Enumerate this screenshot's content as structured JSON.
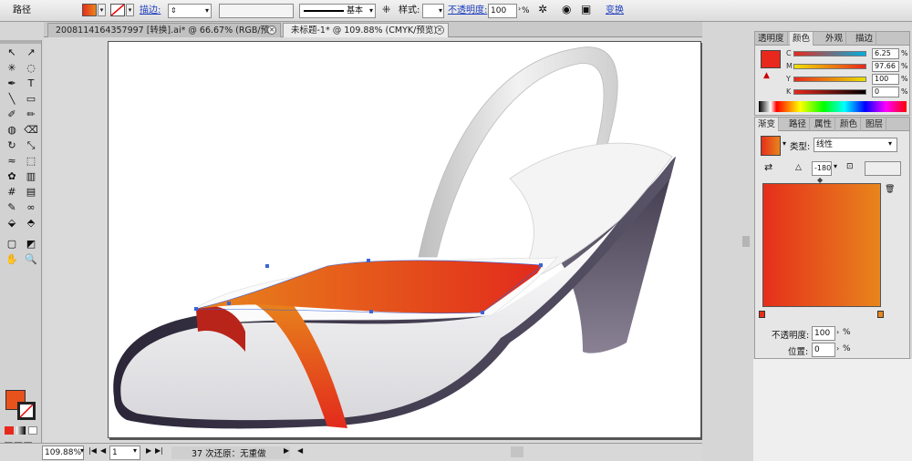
{
  "control_bar": {
    "object_label": "路径",
    "stroke_label": "描边:",
    "stroke_profile": "基本",
    "style_label": "样式:",
    "opacity_label": "不透明度:",
    "opacity_value": "100",
    "opacity_unit": "%",
    "transform_label": "变换"
  },
  "doc_tabs": [
    {
      "title": "2008114164357997 [转换].ai* @ 66.67% (RGB/预览)"
    },
    {
      "title": "未标题-1* @ 109.88% (CMYK/预览)"
    }
  ],
  "status": {
    "zoom": "109.88%",
    "page": "1",
    "undo_text": "37 次还原：无重做"
  },
  "color_panel": {
    "tabs": [
      "透明度",
      "颜色",
      "外观",
      "描边"
    ],
    "active_tab": "颜色",
    "channels": [
      {
        "label": "C",
        "value": "6.25",
        "unit": "%"
      },
      {
        "label": "M",
        "value": "97.66",
        "unit": "%"
      },
      {
        "label": "Y",
        "value": "100",
        "unit": "%"
      },
      {
        "label": "K",
        "value": "0",
        "unit": "%"
      }
    ],
    "fill_color": "#e8281c"
  },
  "gradient_panel": {
    "tabs": [
      "渐变",
      "路径",
      "属性",
      "颜色",
      "图层"
    ],
    "active_tab": "渐变",
    "type_label": "类型:",
    "type_value": "线性",
    "angle_value": "-180",
    "opacity_label": "不透明度:",
    "opacity_value": "100",
    "location_label": "位置:",
    "location_value": "0",
    "unit": "%",
    "gradient_start": "#e52f1b",
    "gradient_end": "#e8851c"
  },
  "toolbox": {
    "tool_icons": [
      "selection-icon",
      "direct-selection-icon",
      "magic-wand-icon",
      "lasso-icon",
      "pen-icon",
      "type-icon",
      "line-icon",
      "rectangle-icon",
      "paintbrush-icon",
      "pencil-icon",
      "blob-brush-icon",
      "eraser-icon",
      "rotate-icon",
      "scale-icon",
      "warp-icon",
      "free-transform-icon",
      "symbol-sprayer-icon",
      "graph-icon",
      "mesh-icon",
      "gradient-icon",
      "eyedropper-icon",
      "blend-icon",
      "live-paint-icon",
      "live-paint-select-icon",
      "artboard-icon",
      "slice-icon",
      "hand-icon",
      "zoom-icon"
    ]
  }
}
